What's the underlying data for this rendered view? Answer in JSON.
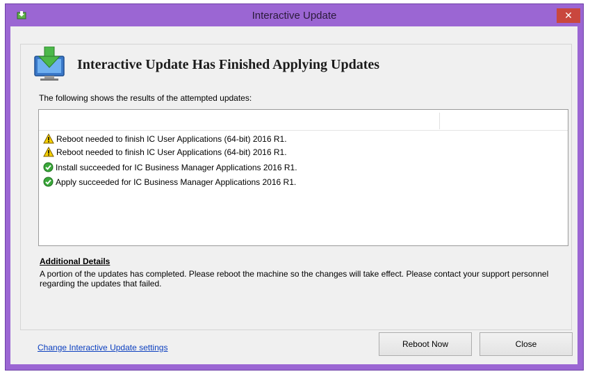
{
  "window": {
    "title": "Interactive Update",
    "close_glyph": "✕"
  },
  "header": {
    "title": "Interactive Update Has Finished Applying Updates",
    "icon": "monitor-download-icon"
  },
  "intro_text": "The following shows the results of the attempted updates:",
  "results": [
    {
      "status": "warning",
      "icon": "warning-icon",
      "text": "Reboot needed to finish IC User Applications (64-bit) 2016 R1."
    },
    {
      "status": "warning",
      "icon": "warning-icon",
      "text": "Reboot needed to finish IC User Applications (64-bit) 2016 R1."
    },
    {
      "status": "success",
      "icon": "check-circle-icon",
      "text": "Install succeeded for IC Business Manager Applications 2016 R1."
    },
    {
      "status": "success",
      "icon": "check-circle-icon",
      "text": "Apply succeeded for IC Business Manager Applications 2016 R1."
    }
  ],
  "details": {
    "title": "Additional Details",
    "text": "A portion of the updates has completed.  Please reboot the machine so the changes will take effect.  Please contact your support personnel regarding the updates that failed."
  },
  "footer": {
    "settings_link": "Change Interactive Update settings",
    "reboot_label": "Reboot Now",
    "close_label": "Close"
  },
  "colors": {
    "frame": "#9b66d3",
    "close_button": "#c9473e",
    "link": "#0b3fbf",
    "warning": "#f5d000",
    "success": "#3aa83a"
  }
}
